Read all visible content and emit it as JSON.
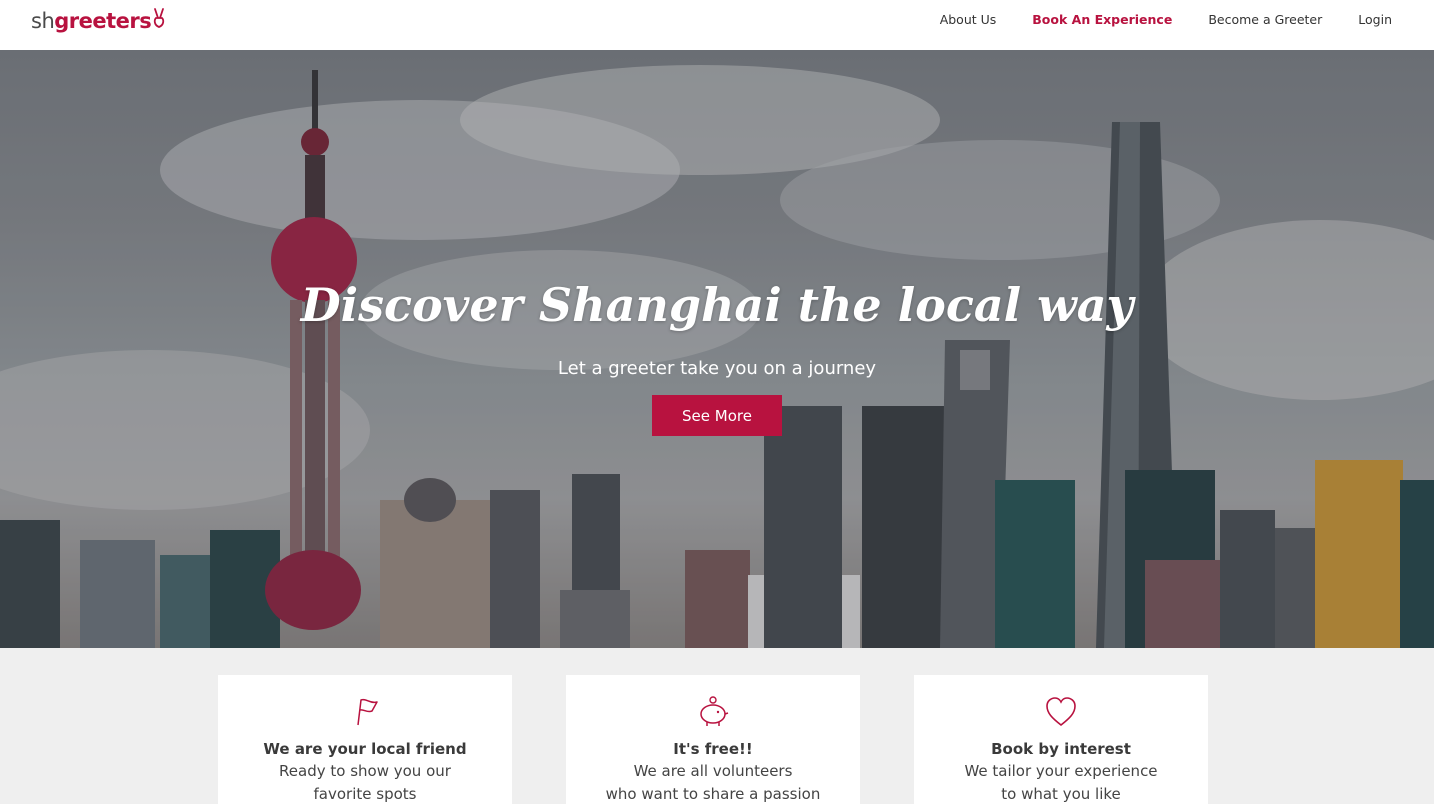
{
  "brand": {
    "prefix": "sh",
    "name": "greeters",
    "accent_color": "#b8123f",
    "icon": "peace-hand-icon"
  },
  "nav": {
    "items": [
      {
        "label": "About Us",
        "active": false
      },
      {
        "label": "Book An Experience",
        "active": true
      },
      {
        "label": "Become a Greeter",
        "active": false
      },
      {
        "label": "Login",
        "active": false
      }
    ]
  },
  "hero": {
    "title": "Discover Shanghai the local way",
    "subtitle": "Let a greeter take you on a journey",
    "button_label": "See More",
    "button_color": "#b8123f",
    "background": "shanghai-skyline-photo"
  },
  "features": [
    {
      "icon": "flag-icon",
      "title": "We are your local friend",
      "line1": "Ready to show you our",
      "line2": "favorite spots"
    },
    {
      "icon": "piggy-bank-icon",
      "title": "It's free!!",
      "line1": "We are all volunteers",
      "line2": "who want to share a passion"
    },
    {
      "icon": "heart-icon",
      "title": "Book by interest",
      "line1": "We tailor your experience",
      "line2": "to what you like"
    }
  ]
}
